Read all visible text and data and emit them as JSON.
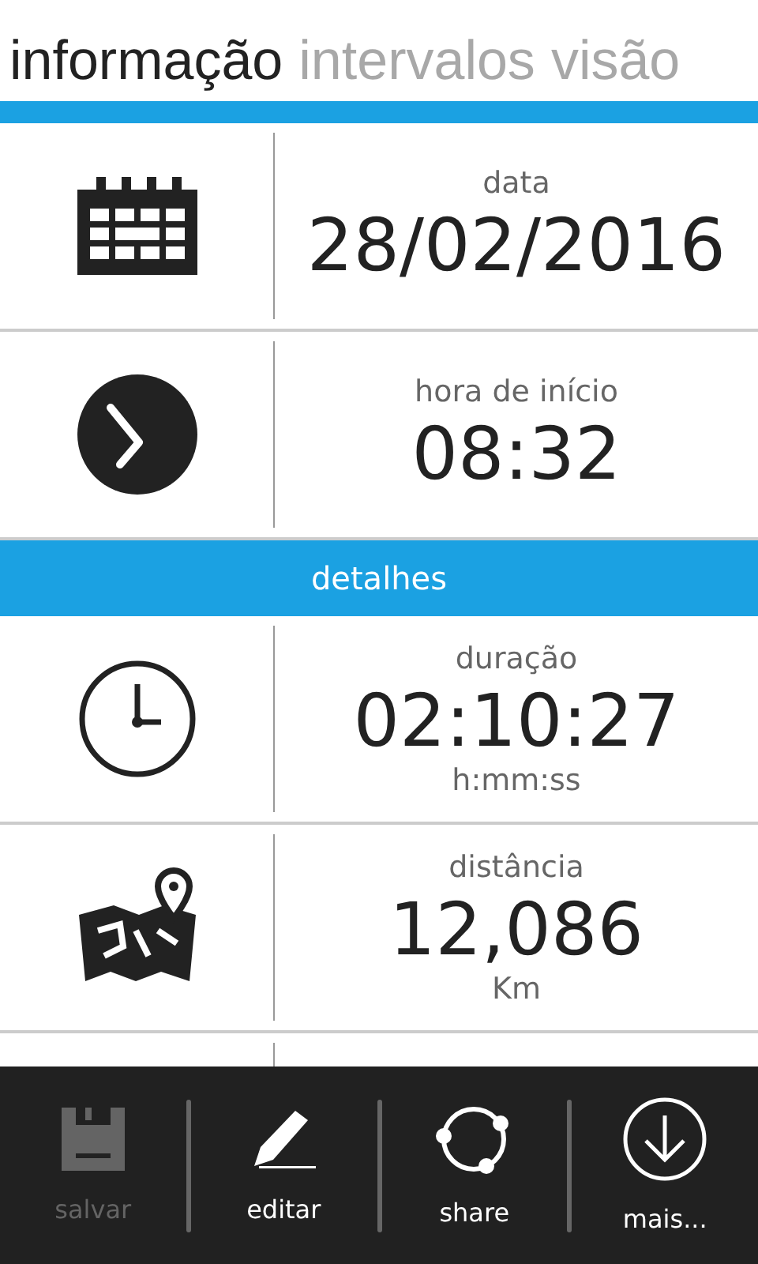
{
  "tabs": [
    {
      "label": "informação",
      "selected": true
    },
    {
      "label": "intervalos",
      "selected": false
    },
    {
      "label": "visão",
      "selected": false
    }
  ],
  "items": [
    {
      "kind": "row",
      "label": "data",
      "value": "28/02/2016"
    },
    {
      "kind": "row",
      "label": "hora de início",
      "value": "08:32"
    },
    {
      "kind": "header",
      "label": "detalhes"
    },
    {
      "kind": "row",
      "label": "duração",
      "value": "02:10:27",
      "unit": "h:mm:ss"
    },
    {
      "kind": "row",
      "label": "distância",
      "value": "12,086",
      "unit": "Km"
    },
    {
      "kind": "row"
    }
  ],
  "app_bar": [
    {
      "label": "salvar",
      "disabled": true
    },
    {
      "label": "editar",
      "disabled": false
    },
    {
      "label": "share",
      "disabled": false
    },
    {
      "label": "mais...",
      "disabled": false
    }
  ]
}
